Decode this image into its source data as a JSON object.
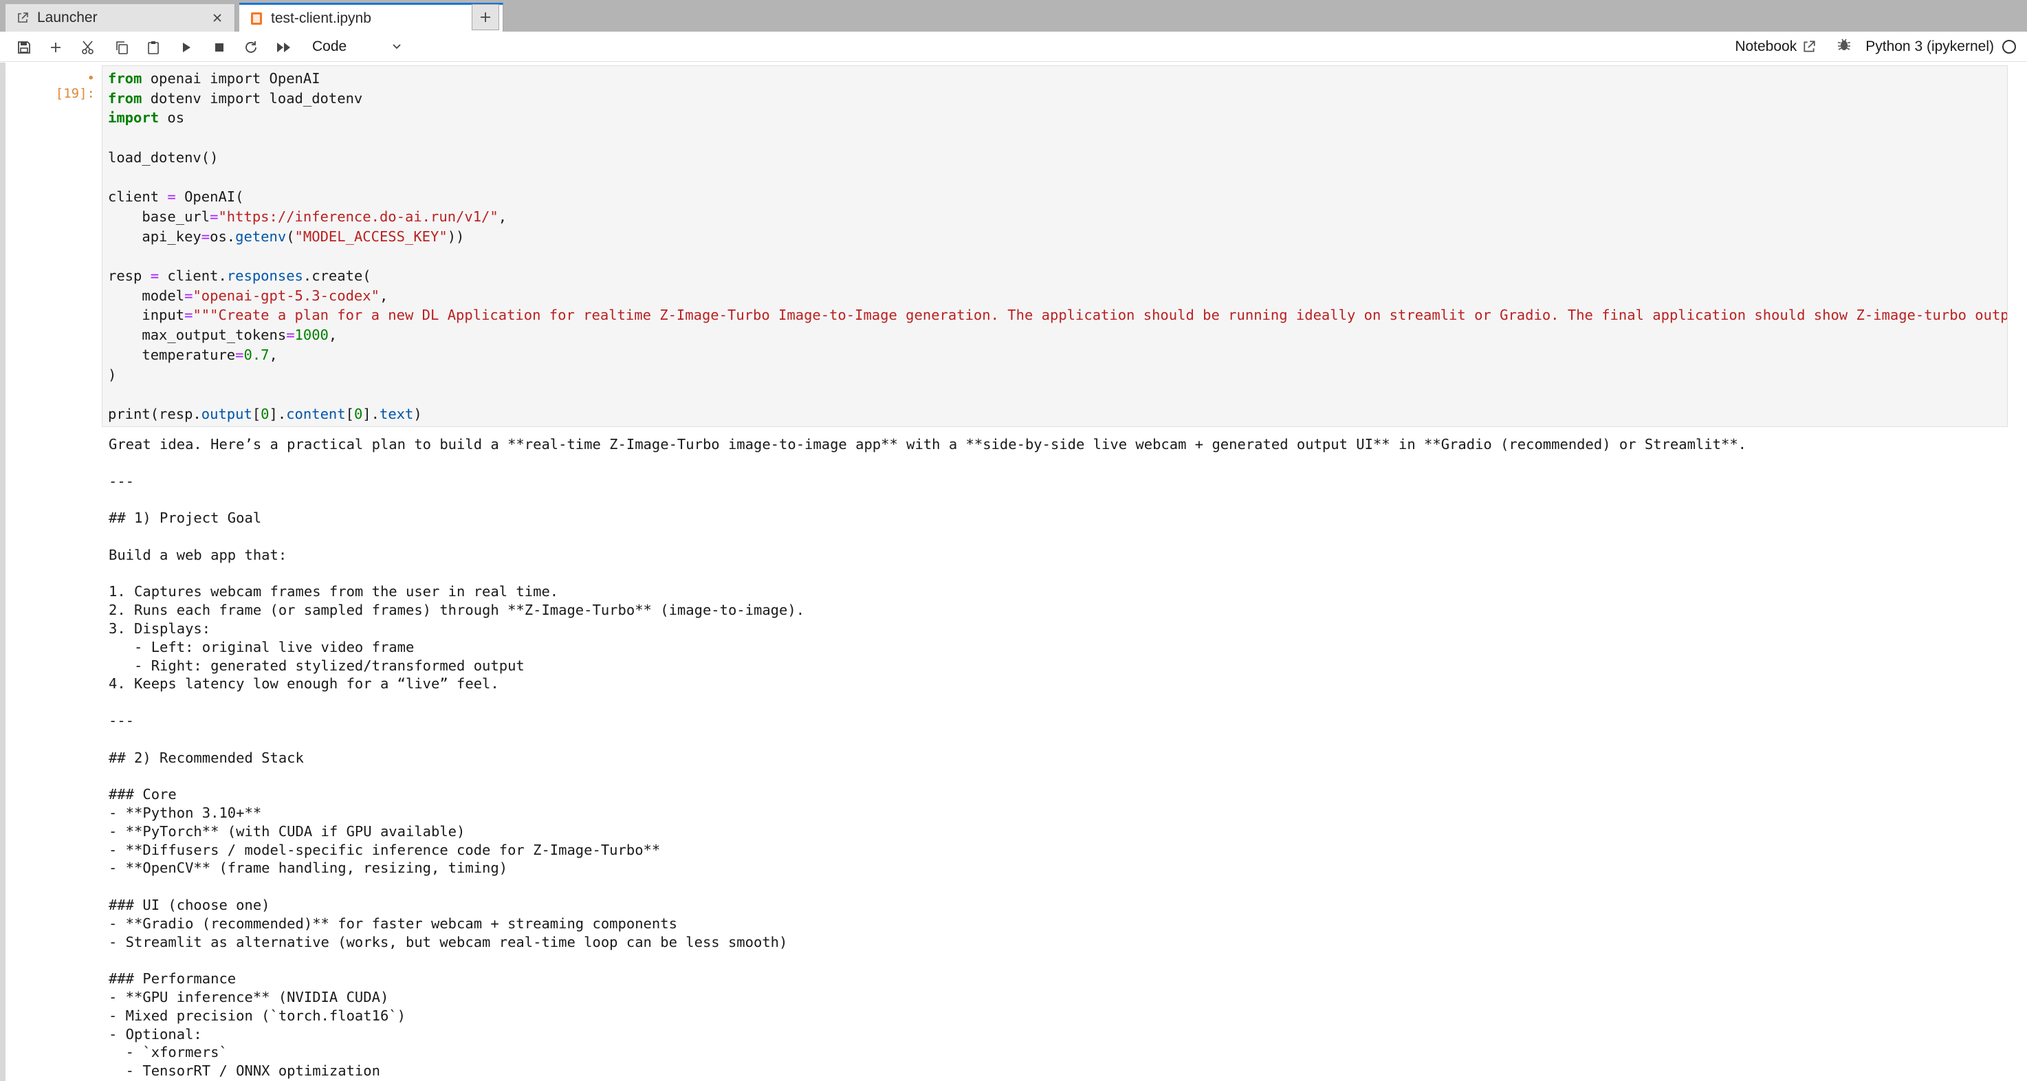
{
  "tabs": [
    {
      "label": "Launcher"
    },
    {
      "label": "test-client.ipynb"
    }
  ],
  "toolbar": {
    "cell_type": "Code",
    "notebook_label": "Notebook",
    "kernel_label": "Python 3 (ipykernel)"
  },
  "cell": {
    "prompt": "• [19]:",
    "code_lines": [
      "from openai import OpenAI",
      "from dotenv import load_dotenv",
      "import os",
      "",
      "load_dotenv()",
      "",
      "client = OpenAI(",
      "    base_url=\"https://inference.do-ai.run/v1/\",",
      "    api_key=os.getenv(\"MODEL_ACCESS_KEY\"))",
      "",
      "resp = client.responses.create(",
      "    model=\"openai-gpt-5.3-codex\",",
      "    input=\"\"\"Create a plan for a new DL Application for realtime Z-Image-Turbo Image-to-Image generation. The application should be running ideally on streamlit or Gradio. The final application should show Z-image-turbo outp",
      "    max_output_tokens=1000,",
      "    temperature=0.7,",
      ")",
      "",
      "print(resp.output[0].content[0].text)"
    ],
    "output_lines": [
      "Great idea. Here’s a practical plan to build a **real-time Z-Image-Turbo image-to-image app** with a **side-by-side live webcam + generated output UI** in **Gradio (recommended) or Streamlit**.",
      "",
      "---",
      "",
      "## 1) Project Goal",
      "",
      "Build a web app that:",
      "",
      "1. Captures webcam frames from the user in real time.",
      "2. Runs each frame (or sampled frames) through **Z-Image-Turbo** (image-to-image).",
      "3. Displays:",
      "   - Left: original live video frame",
      "   - Right: generated stylized/transformed output",
      "4. Keeps latency low enough for a “live” feel.",
      "",
      "---",
      "",
      "## 2) Recommended Stack",
      "",
      "### Core",
      "- **Python 3.10+**",
      "- **PyTorch** (with CUDA if GPU available)",
      "- **Diffusers / model-specific inference code for Z-Image-Turbo**",
      "- **OpenCV** (frame handling, resizing, timing)",
      "",
      "### UI (choose one)",
      "- **Gradio (recommended)** for faster webcam + streaming components",
      "- Streamlit as alternative (works, but webcam real-time loop can be less smooth)",
      "",
      "### Performance",
      "- **GPU inference** (NVIDIA CUDA)",
      "- Mixed precision (`torch.float16`)",
      "- Optional:",
      "  - `xformers`",
      "  - TensorRT / ONNX optimization"
    ]
  }
}
